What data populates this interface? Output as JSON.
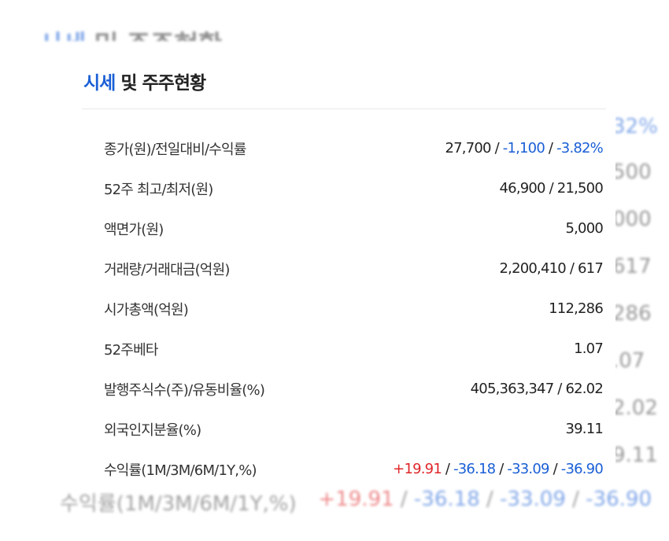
{
  "title": {
    "prefix": "시세",
    "rest": "및 주주현황"
  },
  "colors": {
    "accent": "#1a5fd6",
    "up": "#e0262a",
    "down": "#1a5fd6",
    "text": "#222222"
  },
  "rows": [
    {
      "label": "종가(원)/전일대비/수익률",
      "close": "27,700",
      "change": "-1,100",
      "rate": "-3.82%"
    },
    {
      "label": "52주 최고/최저(원)",
      "value": "46,900 / 21,500"
    },
    {
      "label": "액면가(원)",
      "value": "5,000"
    },
    {
      "label": "거래량/거래대금(억원)",
      "value": "2,200,410 / 617"
    },
    {
      "label": "시가총액(억원)",
      "value": "112,286"
    },
    {
      "label": "52주베타",
      "value": "1.07"
    },
    {
      "label": "발행주식수(주)/유동비율(%)",
      "value": "405,363,347 / 62.02"
    },
    {
      "label": "외국인지분율(%)",
      "value": "39.11"
    },
    {
      "label": "수익률(1M/3M/6M/1Y,%)",
      "r1m": "+19.91",
      "r3m": "-36.18",
      "r6m": "-33.09",
      "r1y": "-36.90"
    }
  ],
  "background": {
    "right_edge": [
      "32%",
      "500",
      "000",
      "617",
      "286",
      ".07",
      "2.02",
      "9.11"
    ]
  }
}
